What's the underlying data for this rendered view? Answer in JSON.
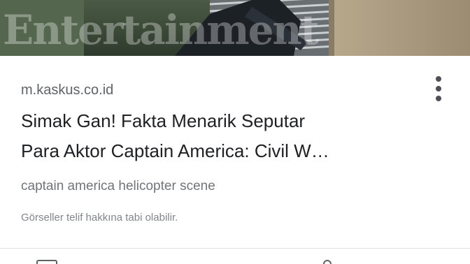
{
  "hero": {
    "watermark_text": "Entertainment",
    "icon": "article-image"
  },
  "result": {
    "domain": "m.kaskus.co.id",
    "title_line1": "Simak Gan! Fakta Menarik Seputar",
    "title_line2": "Para Aktor Captain America: Civil W…",
    "subtitle": "captain america helicopter scene",
    "copyright_notice": "Görseller telif hakkına tabi olabilir.",
    "menu_icon": "more-vert-icon"
  },
  "bottom_bar": {
    "left_icon": "bookmark-icon",
    "right_icon": "share-icon"
  },
  "colors": {
    "title": "#202124",
    "domain": "#5f6368",
    "subtitle": "#70757a",
    "notice": "#80868b",
    "divider": "#e0e0e0"
  }
}
